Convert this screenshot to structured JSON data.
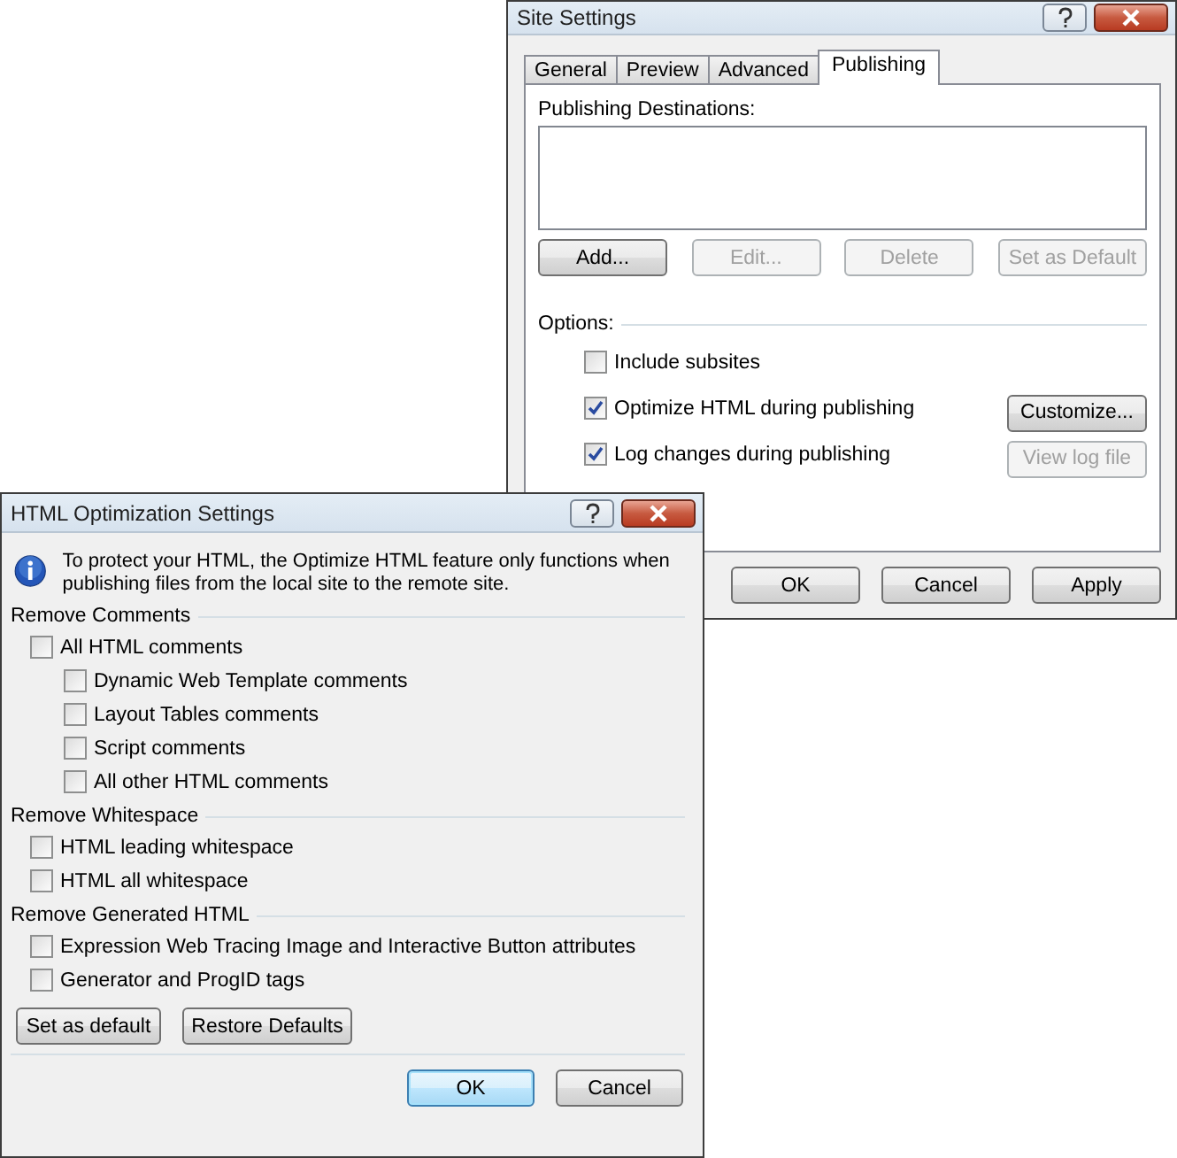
{
  "site_settings": {
    "title": "Site Settings",
    "tabs": [
      {
        "label": "General",
        "selected": false
      },
      {
        "label": "Preview",
        "selected": false
      },
      {
        "label": "Advanced",
        "selected": false
      },
      {
        "label": "Publishing",
        "selected": true
      }
    ],
    "destinations_label": "Publishing Destinations:",
    "destination_buttons": [
      {
        "label": "Add...",
        "disabled": false
      },
      {
        "label": "Edit...",
        "disabled": true
      },
      {
        "label": "Delete",
        "disabled": true
      },
      {
        "label": "Set as Default",
        "disabled": true
      }
    ],
    "options_label": "Options:",
    "options": [
      {
        "label": "Include subsites",
        "checked": false
      },
      {
        "label": "Optimize HTML during publishing",
        "checked": true,
        "button": {
          "label": "Customize...",
          "disabled": false
        }
      },
      {
        "label": "Log changes during publishing",
        "checked": true,
        "button": {
          "label": "View log file",
          "disabled": true
        }
      }
    ],
    "buttons": [
      {
        "label": "OK",
        "default": false
      },
      {
        "label": "Cancel",
        "default": false
      },
      {
        "label": "Apply",
        "default": false
      }
    ]
  },
  "html_optimization": {
    "title": "HTML Optimization Settings",
    "info": "To protect your HTML, the Optimize HTML feature only functions when publishing files from the local site to the remote site.",
    "sections": [
      {
        "title": "Remove Comments",
        "items": [
          {
            "label": "All HTML comments",
            "checked": false,
            "children": [
              {
                "label": "Dynamic Web Template comments",
                "checked": false
              },
              {
                "label": "Layout Tables comments",
                "checked": false
              },
              {
                "label": "Script comments",
                "checked": false
              },
              {
                "label": "All other HTML comments",
                "checked": false
              }
            ]
          }
        ]
      },
      {
        "title": "Remove Whitespace",
        "items": [
          {
            "label": "HTML leading whitespace",
            "checked": false
          },
          {
            "label": "HTML all whitespace",
            "checked": false
          }
        ]
      },
      {
        "title": "Remove Generated HTML",
        "items": [
          {
            "label": "Expression Web Tracing Image and Interactive Button attributes",
            "checked": false
          },
          {
            "label": "Generator and ProgID tags",
            "checked": false
          }
        ]
      }
    ],
    "default_buttons": [
      "Set as default",
      "Restore Defaults"
    ],
    "buttons": [
      {
        "label": "OK",
        "default": true
      },
      {
        "label": "Cancel",
        "default": false
      }
    ]
  }
}
